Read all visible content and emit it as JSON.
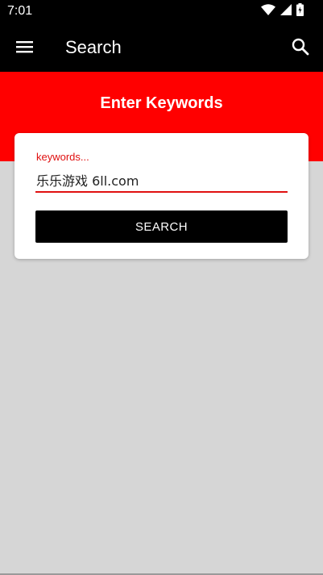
{
  "status_bar": {
    "time": "7:01",
    "icons": [
      "wifi-icon",
      "signal-icon",
      "battery-icon"
    ]
  },
  "app_bar": {
    "title": "Search",
    "icons": [
      "hamburger-menu-icon",
      "search-icon"
    ]
  },
  "hero": {
    "title": "Enter Keywords"
  },
  "search_form": {
    "label": "keywords...",
    "value": "乐乐游戏 6ll.com",
    "button_label": "SEARCH"
  },
  "colors": {
    "accent_red": "#ff0000",
    "bar_black": "#000000",
    "background_gray": "#d6d6d6"
  }
}
